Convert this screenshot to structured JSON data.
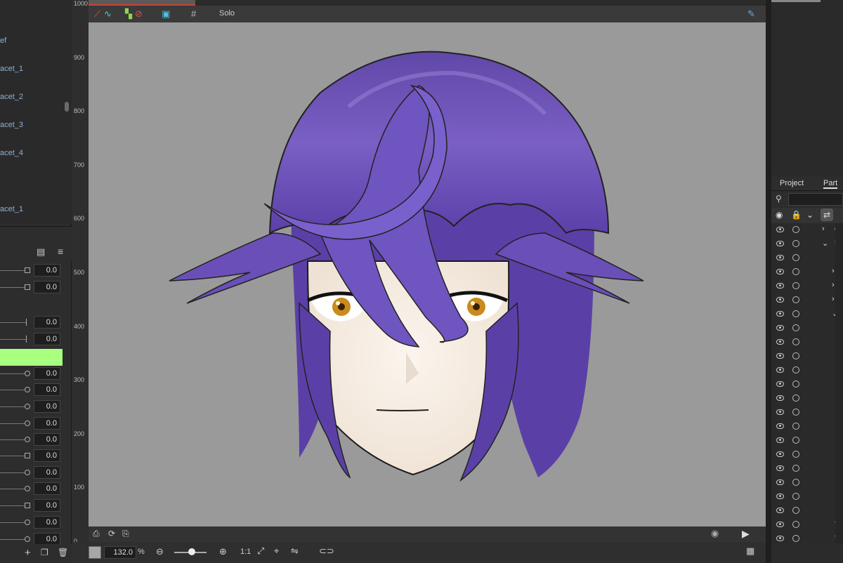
{
  "deformers": [
    "ef",
    "acet_1",
    "acet_2",
    "acet_3",
    "acet_4",
    "acet_1"
  ],
  "params": [
    {
      "knob": "square",
      "value": "0.0"
    },
    {
      "knob": "square",
      "value": "0.0"
    },
    {
      "knob": "tick",
      "value": "0.0"
    },
    {
      "knob": "tick",
      "value": "0.0"
    },
    {
      "knob": "green",
      "value": ""
    },
    {
      "knob": "circle",
      "value": "0.0"
    },
    {
      "knob": "circle",
      "value": "0.0"
    },
    {
      "knob": "circle",
      "value": "0.0"
    },
    {
      "knob": "circle",
      "value": "0.0"
    },
    {
      "knob": "circle",
      "value": "0.0"
    },
    {
      "knob": "square",
      "value": "0.0"
    },
    {
      "knob": "circle",
      "value": "0.0"
    },
    {
      "knob": "circle",
      "value": "0.0"
    },
    {
      "knob": "square",
      "value": "0.0"
    },
    {
      "knob": "circle",
      "value": "0.0"
    },
    {
      "knob": "circle",
      "value": "0.0"
    }
  ],
  "ruler": [
    "1000",
    "900",
    "800",
    "700",
    "600",
    "500",
    "400",
    "300",
    "200",
    "100",
    "0"
  ],
  "toolbar": {
    "solo_label": "Solo"
  },
  "bottom": {
    "zoom": "132.0",
    "zoom_unit": "%",
    "actual_size": "1:1"
  },
  "right_panel": {
    "tabs": [
      "Project",
      "Part"
    ],
    "parts": [
      {
        "name": "ca",
        "expand": "›",
        "indent": 0
      },
      {
        "name": "F",
        "expand": "⌄",
        "indent": 0
      },
      {
        "name": "",
        "expand": "",
        "indent": 0
      },
      {
        "name": "",
        "expand": "›",
        "indent": 1
      },
      {
        "name": "",
        "expand": "›",
        "indent": 1
      },
      {
        "name": "",
        "expand": "›",
        "indent": 1
      },
      {
        "name": "",
        "expand": "⌄",
        "indent": 1
      },
      {
        "name": "",
        "expand": "",
        "indent": 0
      },
      {
        "name": "",
        "expand": "",
        "indent": 0
      },
      {
        "name": "",
        "expand": "",
        "indent": 0
      },
      {
        "name": "",
        "expand": "",
        "indent": 0
      },
      {
        "name": "",
        "expand": "",
        "indent": 0
      },
      {
        "name": "",
        "expand": "",
        "indent": 0
      },
      {
        "name": "",
        "expand": "",
        "indent": 0
      },
      {
        "name": "",
        "expand": "",
        "indent": 0
      },
      {
        "name": "",
        "expand": "",
        "indent": 0
      },
      {
        "name": "",
        "expand": "",
        "indent": 0
      },
      {
        "name": "",
        "expand": "",
        "indent": 0
      },
      {
        "name": "",
        "expand": "",
        "indent": 0
      },
      {
        "name": "",
        "expand": "",
        "indent": 0
      },
      {
        "name": "",
        "expand": "",
        "indent": 0
      },
      {
        "name": "fr",
        "expand": "",
        "indent": 0
      },
      {
        "name": "fr",
        "expand": "",
        "indent": 0
      }
    ]
  },
  "colors": {
    "hair": "#6a4fb0",
    "hair_dark": "#4b3490",
    "skin": "#f7eee6",
    "eye": "#c98a1e",
    "canvas": "#9a9a9a",
    "active_param": "#a8ff80"
  }
}
